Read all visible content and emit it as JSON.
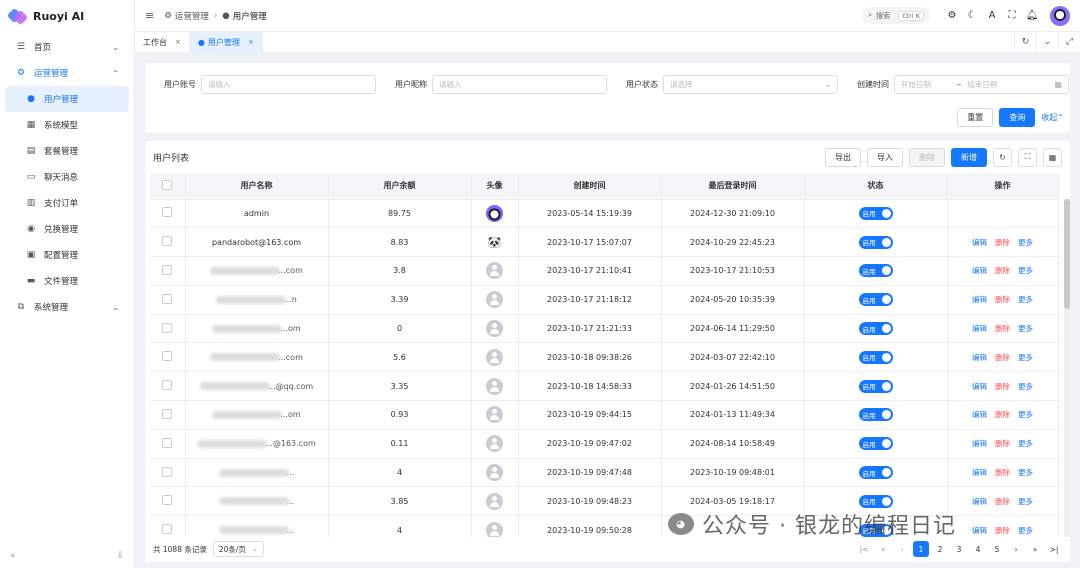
{
  "app": {
    "title": "Ruoyi AI"
  },
  "sidebar": {
    "items": [
      {
        "label": "首页",
        "icon": "dashboard-icon",
        "chevron": "⌄"
      },
      {
        "label": "运营管理",
        "icon": "operations-icon",
        "chevron": "⌃",
        "open": true
      },
      {
        "label": "用户管理",
        "icon": "user-icon",
        "active": true
      },
      {
        "label": "系统模型",
        "icon": "model-icon"
      },
      {
        "label": "套餐管理",
        "icon": "package-icon"
      },
      {
        "label": "聊天消息",
        "icon": "chat-icon"
      },
      {
        "label": "支付订单",
        "icon": "order-icon"
      },
      {
        "label": "兑换管理",
        "icon": "exchange-icon"
      },
      {
        "label": "配置管理",
        "icon": "config-icon"
      },
      {
        "label": "文件管理",
        "icon": "folder-icon"
      },
      {
        "label": "系统管理",
        "icon": "system-icon",
        "chevron": "⌄"
      }
    ],
    "footer": {
      "collapse": "«",
      "pin": "⇩"
    }
  },
  "header": {
    "breadcrumb": [
      {
        "label": "运营管理"
      },
      {
        "label": "用户管理"
      }
    ],
    "search": {
      "label": "搜索",
      "shortcut": "Ctrl K"
    }
  },
  "tabs": [
    {
      "label": "工作台",
      "close": "×"
    },
    {
      "label": "用户管理",
      "close": "×",
      "active": true
    }
  ],
  "filter": {
    "fields": [
      {
        "label": "用户账号",
        "placeholder": "请输入"
      },
      {
        "label": "用户昵称",
        "placeholder": "请输入"
      },
      {
        "label": "用户状态",
        "placeholder": "请选择"
      },
      {
        "label": "创建时间",
        "start": "开始日期",
        "arrow": "→",
        "end": "结束日期"
      }
    ],
    "reset": "重置",
    "query": "查询",
    "collapse": "收起"
  },
  "table": {
    "title": "用户列表",
    "toolbar": {
      "export": "导出",
      "import": "导入",
      "delete": "删除",
      "add": "新增"
    },
    "columns": [
      "用户名称",
      "用户余额",
      "头像",
      "创建时间",
      "最后登录时间",
      "状态",
      "操作"
    ],
    "status_label": "启用",
    "ops": {
      "edit": "编辑",
      "delete": "删除",
      "more": "更多"
    },
    "rows": [
      {
        "name": "admin",
        "name_blur": false,
        "balance": "89.75",
        "avatar": "panda",
        "created": "2023-05-14 15:19:39",
        "last_login": "2024-12-30 21:09:10",
        "ops": false
      },
      {
        "name": "pandarobot@163.com",
        "name_blur": false,
        "balance": "8.83",
        "avatar": "emoji",
        "created": "2023-10-17 15:07:07",
        "last_login": "2024-10-29 22:45:23",
        "ops": true
      },
      {
        "name": "...com",
        "name_blur": true,
        "balance": "3.8",
        "avatar": "default",
        "created": "2023-10-17 21:10:41",
        "last_login": "2023-10-17 21:10:53",
        "ops": true
      },
      {
        "name": "...n",
        "name_blur": true,
        "balance": "3.39",
        "avatar": "default",
        "created": "2023-10-17 21:18:12",
        "last_login": "2024-05-20 10:35:39",
        "ops": true
      },
      {
        "name": "...om",
        "name_blur": true,
        "balance": "0",
        "avatar": "default",
        "created": "2023-10-17 21:21:33",
        "last_login": "2024-06-14 11:29:50",
        "ops": true
      },
      {
        "name": "...com",
        "name_blur": true,
        "balance": "5.6",
        "avatar": "default",
        "created": "2023-10-18 09:38:26",
        "last_login": "2024-03-07 22:42:10",
        "ops": true
      },
      {
        "name": "...@qq.com",
        "name_blur": true,
        "balance": "3.35",
        "avatar": "default",
        "created": "2023-10-18 14:58:33",
        "last_login": "2024-01-26 14:51:50",
        "ops": true
      },
      {
        "name": "...om",
        "name_blur": true,
        "balance": "0.93",
        "avatar": "default",
        "created": "2023-10-19 09:44:15",
        "last_login": "2024-01-13 11:49:34",
        "ops": true
      },
      {
        "name": "...@163.com",
        "name_blur": true,
        "balance": "0.11",
        "avatar": "default",
        "created": "2023-10-19 09:47:02",
        "last_login": "2024-08-14 10:58:49",
        "ops": true
      },
      {
        "name": "...",
        "name_blur": true,
        "balance": "4",
        "avatar": "default",
        "created": "2023-10-19 09:47:48",
        "last_login": "2023-10-19 09:48:01",
        "ops": true
      },
      {
        "name": "...",
        "name_blur": true,
        "balance": "3.85",
        "avatar": "default",
        "created": "2023-10-19 09:48:23",
        "last_login": "2024-03-05 19:18:17",
        "ops": true
      },
      {
        "name": "...",
        "name_blur": true,
        "balance": "4",
        "avatar": "default",
        "created": "2023-10-19 09:50:28",
        "last_login": "",
        "ops": true
      }
    ]
  },
  "pagination": {
    "total": "共 1088 条记录",
    "page_size": "20条/页",
    "pages": [
      "1",
      "2",
      "3",
      "4",
      "5"
    ],
    "current": "1"
  },
  "watermark": "公众号 · 银龙的编程日记"
}
